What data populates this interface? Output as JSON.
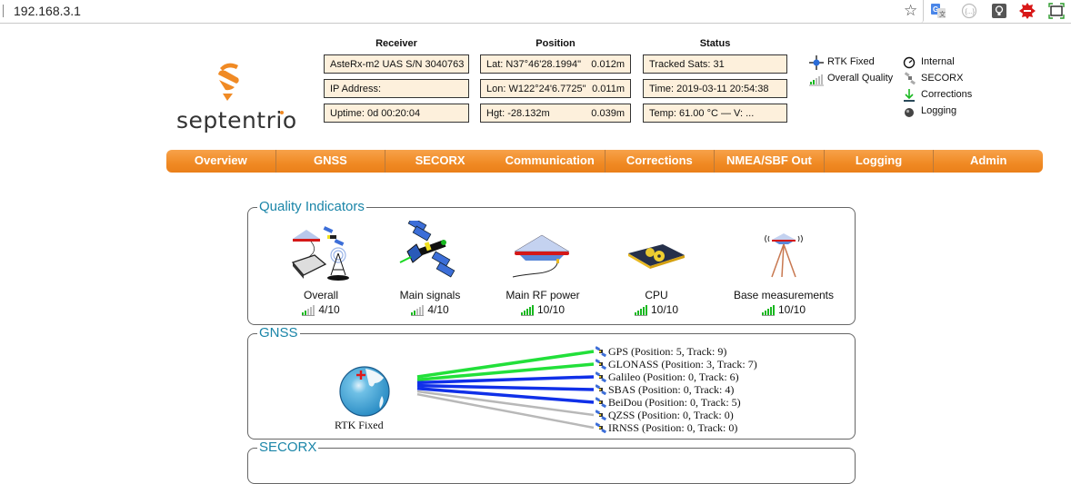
{
  "browser": {
    "url": "192.168.3.1",
    "bookmark_icon": "star-icon",
    "extensions": [
      "google-translate-icon",
      "json-viewer-icon",
      "bulb-icon",
      "adblock-icon",
      "fullscreen-icon"
    ]
  },
  "header": {
    "logo_text": "septentrio",
    "receiver": {
      "title": "Receiver",
      "model": "AsteRx-m2 UAS S/N 3040763",
      "ip": "IP Address:",
      "uptime": "Uptime: 0d 00:20:04"
    },
    "position": {
      "title": "Position",
      "lat": "Lat:  N37°46'28.1994\"",
      "lat_acc": "0.012m",
      "lon": "Lon: W122°24'6.7725\"",
      "lon_acc": "0.011m",
      "hgt": "Hgt:  -28.132m",
      "hgt_acc": "0.039m"
    },
    "status": {
      "title": "Status",
      "tracked": "Tracked Sats: 31",
      "time": "Time: 2019-03-11 20:54:38",
      "temp": "Temp: 61.00 °C — V: ..."
    },
    "legend": {
      "rtk": "RTK Fixed",
      "overall": "Overall Quality",
      "internal": "Internal",
      "secorx": "SECORX",
      "corrections": "Corrections",
      "logging": "Logging"
    }
  },
  "nav": {
    "items": [
      "Overview",
      "GNSS",
      "SECORX",
      "Communication",
      "Corrections",
      "NMEA/SBF Out",
      "Logging",
      "Admin"
    ]
  },
  "quality": {
    "title": "Quality Indicators",
    "items": [
      {
        "label": "Overall",
        "score": "4/10",
        "value": 4
      },
      {
        "label": "Main signals",
        "score": "4/10",
        "value": 4
      },
      {
        "label": "Main RF power",
        "score": "10/10",
        "value": 10
      },
      {
        "label": "CPU",
        "score": "10/10",
        "value": 10
      },
      {
        "label": "Base measurements",
        "score": "10/10",
        "value": 10
      }
    ]
  },
  "gnss": {
    "title": "GNSS",
    "fix_label": "RTK Fixed",
    "constellations": [
      {
        "text": "GPS (Position: 5, Track: 9)",
        "color": "#22e03a"
      },
      {
        "text": "GLONASS (Position: 3, Track: 7)",
        "color": "#22e03a"
      },
      {
        "text": "Galileo (Position: 0, Track: 6)",
        "color": "#1030e8"
      },
      {
        "text": "SBAS (Position: 0, Track: 4)",
        "color": "#1030e8"
      },
      {
        "text": "BeiDou (Position: 0, Track: 5)",
        "color": "#1030e8"
      },
      {
        "text": "QZSS (Position: 0, Track: 0)",
        "color": "#b8b8b8"
      },
      {
        "text": "IRNSS (Position: 0, Track: 0)",
        "color": "#b8b8b8"
      }
    ]
  },
  "secorx": {
    "title": "SECORX"
  }
}
